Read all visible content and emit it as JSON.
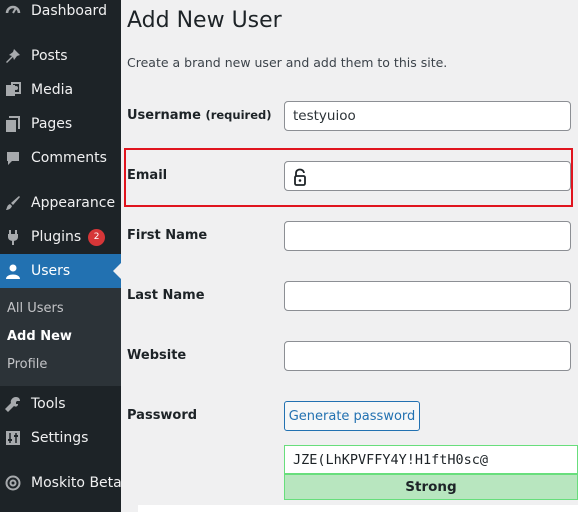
{
  "sidebar": {
    "items": [
      {
        "key": "dashboard",
        "label": "Dashboard",
        "icon": "dashboard-icon"
      },
      {
        "key": "posts",
        "label": "Posts",
        "icon": "pin-icon"
      },
      {
        "key": "media",
        "label": "Media",
        "icon": "media-icon"
      },
      {
        "key": "pages",
        "label": "Pages",
        "icon": "pages-icon"
      },
      {
        "key": "comments",
        "label": "Comments",
        "icon": "comment-icon"
      },
      {
        "key": "appearance",
        "label": "Appearance",
        "icon": "paintbrush-icon"
      },
      {
        "key": "plugins",
        "label": "Plugins",
        "icon": "plug-icon",
        "badge": "2"
      },
      {
        "key": "users",
        "label": "Users",
        "icon": "user-icon"
      },
      {
        "key": "tools",
        "label": "Tools",
        "icon": "wrench-icon"
      },
      {
        "key": "settings",
        "label": "Settings",
        "icon": "sliders-icon"
      },
      {
        "key": "moskito",
        "label": "Moskito Beta",
        "icon": "moskito-icon"
      }
    ],
    "submenu": [
      "All Users",
      "Add New",
      "Profile"
    ],
    "colors": {
      "bg": "#1d2327",
      "active": "#2271b1",
      "submenu_bg": "#2c3338",
      "badge": "#d63638"
    }
  },
  "main": {
    "title": "Add New User",
    "description": "Create a brand new user and add them to this site.",
    "fields": {
      "username": {
        "label": "Username",
        "required": "(required)",
        "value": "testyuioo"
      },
      "email": {
        "label": "Email",
        "value": ""
      },
      "first_name": {
        "label": "First Name",
        "value": ""
      },
      "last_name": {
        "label": "Last Name",
        "value": ""
      },
      "website": {
        "label": "Website",
        "value": ""
      },
      "password": {
        "label": "Password",
        "button": "Generate password",
        "value": "JZE(LhKPVFFY4Y!H1ftH0sc@",
        "strength": "Strong"
      }
    },
    "colors": {
      "highlight": "#e0141e",
      "strong_bg": "#b8e6bf",
      "strong_border": "#68de7c",
      "link": "#2271b1"
    }
  }
}
